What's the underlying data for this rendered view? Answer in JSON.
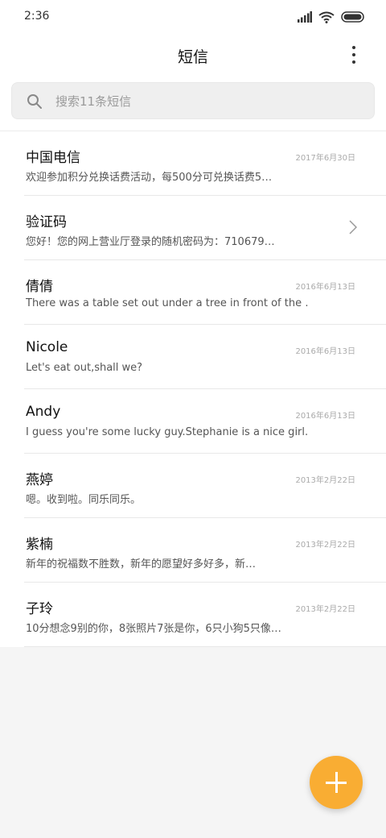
{
  "status_bar": {
    "time": "2:36"
  },
  "header": {
    "title": "短信"
  },
  "search": {
    "placeholder": "搜索11条短信"
  },
  "messages": [
    {
      "name": "中国电信",
      "date": "2017年6月30日",
      "preview": "欢迎参加积分兑换话费活动，每500分可兑换话费5…"
    },
    {
      "name": "验证码",
      "date": "",
      "preview": "您好！您的网上营业厅登录的随机密码为：710679…"
    },
    {
      "name": "倩倩",
      "date": "2016年6月13日",
      "preview": "There was a table set out under a tree in front of the …"
    },
    {
      "name": "Nicole",
      "date": "2016年6月13日",
      "preview": "Let's eat out,shall we?"
    },
    {
      "name": "Andy",
      "date": "2016年6月13日",
      "preview": "I guess you're some lucky guy.Stephanie is a nice girl."
    },
    {
      "name": "燕婷",
      "date": "2013年2月22日",
      "preview": "嗯。收到啦。同乐同乐。"
    },
    {
      "name": "紫楠",
      "date": "2013年2月22日",
      "preview": "新年的祝福数不胜数，新年的愿望好多好多，新…"
    },
    {
      "name": "子玲",
      "date": "2013年2月22日",
      "preview": "10分想念9别的你，8张照片7张是你，6只小狗5只像…"
    }
  ],
  "icons": {
    "more": "more-vertical-icon",
    "search": "search-icon",
    "chevron": "chevron-right-icon",
    "compose": "plus-icon"
  },
  "colors": {
    "accent": "#f9ad33",
    "background": "#f5f5f5"
  }
}
